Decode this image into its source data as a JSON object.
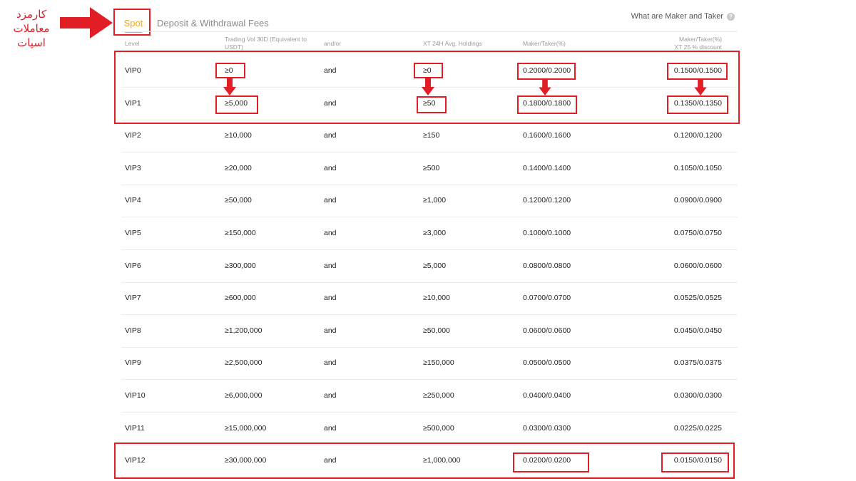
{
  "annotation": {
    "caption_lines": [
      "کارمزد",
      "معاملات",
      "اسپات"
    ],
    "accent_color": "#e11d25"
  },
  "tabs": [
    {
      "label": "Spot",
      "active": true
    },
    {
      "label": "Deposit & Withdrawal Fees",
      "active": false
    }
  ],
  "help_link": {
    "label": "What are Maker and Taker",
    "icon": "question-circle-icon"
  },
  "columns": {
    "level": "Level",
    "volume": "Trading Vol 30D (Equivalent to USDT)",
    "andor": "and/or",
    "holdings": "XT 24H Avg. Holdings",
    "maker_taker": "Maker/Taker(%)",
    "discount_line1": "Maker/Taker(%)",
    "discount_line2": "XT 25 % discount"
  },
  "rows": [
    {
      "level": "VIP0",
      "volume": "≥0",
      "and": "and",
      "holdings": "≥0",
      "maker_taker": "0.2000/0.2000",
      "discount": "0.1500/0.1500"
    },
    {
      "level": "VIP1",
      "volume": "≥5,000",
      "and": "and",
      "holdings": "≥50",
      "maker_taker": "0.1800/0.1800",
      "discount": "0.1350/0.1350"
    },
    {
      "level": "VIP2",
      "volume": "≥10,000",
      "and": "and",
      "holdings": "≥150",
      "maker_taker": "0.1600/0.1600",
      "discount": "0.1200/0.1200"
    },
    {
      "level": "VIP3",
      "volume": "≥20,000",
      "and": "and",
      "holdings": "≥500",
      "maker_taker": "0.1400/0.1400",
      "discount": "0.1050/0.1050"
    },
    {
      "level": "VIP4",
      "volume": "≥50,000",
      "and": "and",
      "holdings": "≥1,000",
      "maker_taker": "0.1200/0.1200",
      "discount": "0.0900/0.0900"
    },
    {
      "level": "VIP5",
      "volume": "≥150,000",
      "and": "and",
      "holdings": "≥3,000",
      "maker_taker": "0.1000/0.1000",
      "discount": "0.0750/0.0750"
    },
    {
      "level": "VIP6",
      "volume": "≥300,000",
      "and": "and",
      "holdings": "≥5,000",
      "maker_taker": "0.0800/0.0800",
      "discount": "0.0600/0.0600"
    },
    {
      "level": "VIP7",
      "volume": "≥600,000",
      "and": "and",
      "holdings": "≥10,000",
      "maker_taker": "0.0700/0.0700",
      "discount": "0.0525/0.0525"
    },
    {
      "level": "VIP8",
      "volume": "≥1,200,000",
      "and": "and",
      "holdings": "≥50,000",
      "maker_taker": "0.0600/0.0600",
      "discount": "0.0450/0.0450"
    },
    {
      "level": "VIP9",
      "volume": "≥2,500,000",
      "and": "and",
      "holdings": "≥150,000",
      "maker_taker": "0.0500/0.0500",
      "discount": "0.0375/0.0375"
    },
    {
      "level": "VIP10",
      "volume": "≥6,000,000",
      "and": "and",
      "holdings": "≥250,000",
      "maker_taker": "0.0400/0.0400",
      "discount": "0.0300/0.0300"
    },
    {
      "level": "VIP11",
      "volume": "≥15,000,000",
      "and": "and",
      "holdings": "≥500,000",
      "maker_taker": "0.0300/0.0300",
      "discount": "0.0225/0.0225"
    },
    {
      "level": "VIP12",
      "volume": "≥30,000,000",
      "and": "and",
      "holdings": "≥1,000,000",
      "maker_taker": "0.0200/0.0200",
      "discount": "0.0150/0.0150"
    }
  ]
}
